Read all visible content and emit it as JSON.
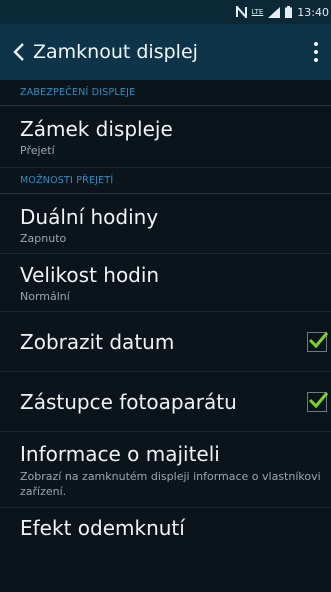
{
  "status_bar": {
    "network_label": "LTE",
    "time": "13:40"
  },
  "app_bar": {
    "title": "Zamknout displej",
    "back_icon": "chevron-left-icon",
    "menu_icon": "overflow-menu-icon"
  },
  "sections": [
    {
      "header": "ZABEZPEČENÍ DISPLEJE",
      "items": [
        {
          "title": "Zámek displeje",
          "subtitle": "Přejetí"
        }
      ]
    },
    {
      "header": "MOŽNOSTI PŘEJETÍ",
      "items": [
        {
          "title": "Duální hodiny",
          "subtitle": "Zapnuto"
        },
        {
          "title": "Velikost hodin",
          "subtitle": "Normální"
        },
        {
          "title": "Zobrazit datum",
          "checked": true
        },
        {
          "title": "Zástupce fotoaparátu",
          "checked": true
        },
        {
          "title": "Informace o majiteli",
          "subtitle": "Zobrazí na zamknutém displeji informace o vlastníkovi zařízení."
        },
        {
          "title": "Efekt odemknutí"
        }
      ]
    }
  ],
  "colors": {
    "background": "#0c141b",
    "app_bar": "#0d3449",
    "section_header_text": "#2f8fbf",
    "checkmark": "#7cd321"
  }
}
